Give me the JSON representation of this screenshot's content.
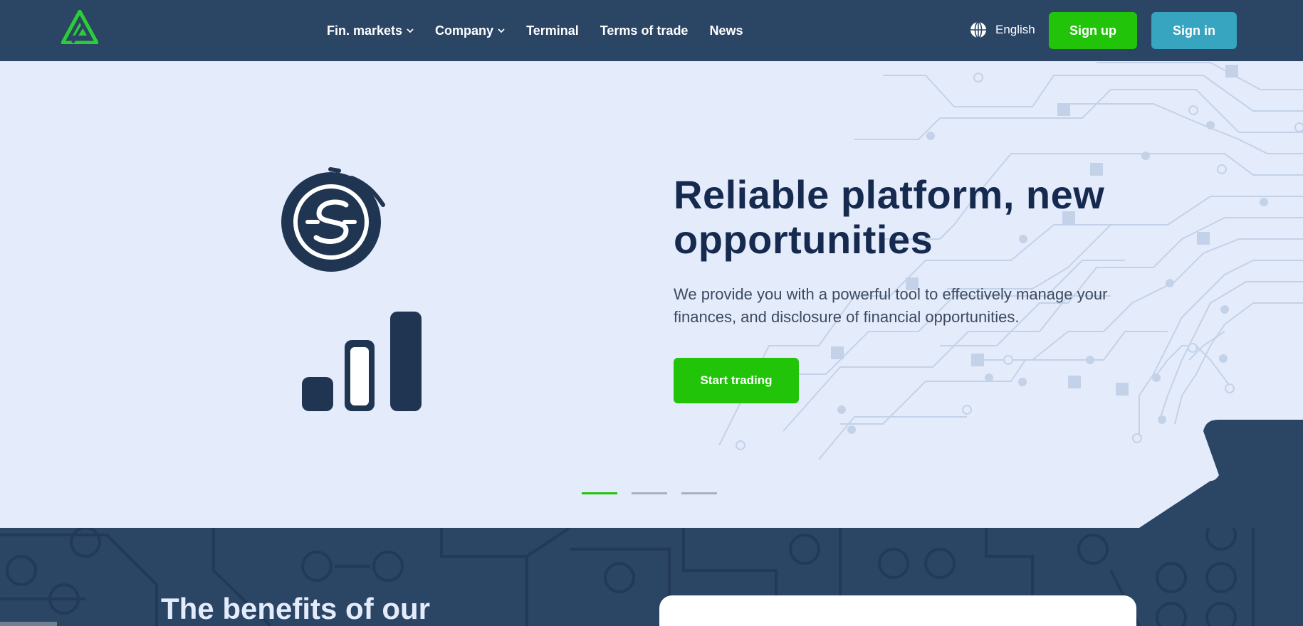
{
  "header": {
    "nav": [
      {
        "label": "Fin. markets",
        "has_dropdown": true
      },
      {
        "label": "Company",
        "has_dropdown": true
      },
      {
        "label": "Terminal",
        "has_dropdown": false
      },
      {
        "label": "Terms of trade",
        "has_dropdown": false
      },
      {
        "label": "News",
        "has_dropdown": false
      }
    ],
    "language": "English",
    "signup_label": "Sign up",
    "signin_label": "Sign in"
  },
  "hero": {
    "title": "Reliable platform, new opportunities",
    "subtitle": "We provide you with a powerful tool to effectively manage your finances, and disclosure of financial opportunities.",
    "cta_label": "Start trading",
    "slides": {
      "count": 3,
      "active": 0
    }
  },
  "benefits": {
    "title": "The benefits of our"
  },
  "colors": {
    "header_bg": "#2b4565",
    "hero_bg": "#e4ecfc",
    "accent_green": "#22c40a",
    "accent_teal": "#37a5c0",
    "title_navy": "#162a4f"
  },
  "icons": {
    "logo": "logo-icon",
    "globe": "globe-icon",
    "chevron": "chevron-down-icon",
    "hero_art": "coin-growth-illustration"
  }
}
